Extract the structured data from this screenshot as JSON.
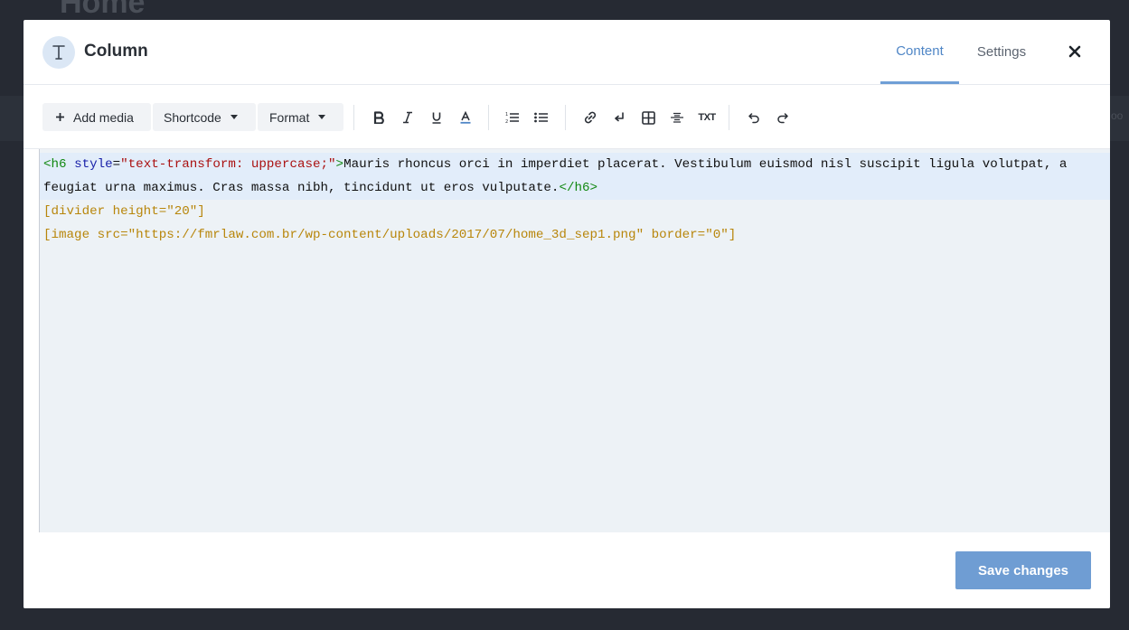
{
  "background": {
    "page_title": "Home",
    "right_fragment": "oo"
  },
  "modal": {
    "title": "Column",
    "title_icon": "text-T-icon",
    "tabs": [
      {
        "label": "Content",
        "active": true
      },
      {
        "label": "Settings",
        "active": false
      }
    ],
    "close_icon": "close-x-icon"
  },
  "toolbar": {
    "add_media_label": "Add media",
    "shortcode_label": "Shortcode",
    "format_label": "Format",
    "icons": [
      "bold-icon",
      "italic-icon",
      "underline-icon",
      "text-color-icon",
      "ordered-list-icon",
      "unordered-list-icon",
      "link-icon",
      "line-break-icon",
      "table-icon",
      "strikethrough-icon",
      "txt-icon",
      "undo-icon",
      "redo-icon"
    ],
    "txt_label": "TXT"
  },
  "editor": {
    "line1": {
      "tag_open": "<h6",
      "attr_name": "style",
      "eq": "=",
      "attr_value": "\"text-transform: uppercase;\"",
      "tag_close_bracket": ">",
      "text": "Mauris rhoncus orci in imperdiet placerat. Vestibulum euismod nisl suscipit ligula volutpat, a"
    },
    "line2": {
      "text": "feugiat urna maximus. Cras massa nibh, tincidunt ut eros vulputate.",
      "end_tag": "</h6>"
    },
    "line3": "[divider height=\"20\"]",
    "line4": "[image src=\"https://fmrlaw.com.br/wp-content/uploads/2017/07/home_3d_sep1.png\" border=\"0\"]"
  },
  "footer": {
    "save_label": "Save changes"
  },
  "colors": {
    "accent": "#4f86c6",
    "save_button": "#6f9dd3",
    "editor_bg": "#edf2f6",
    "overlay": "#262a33"
  }
}
